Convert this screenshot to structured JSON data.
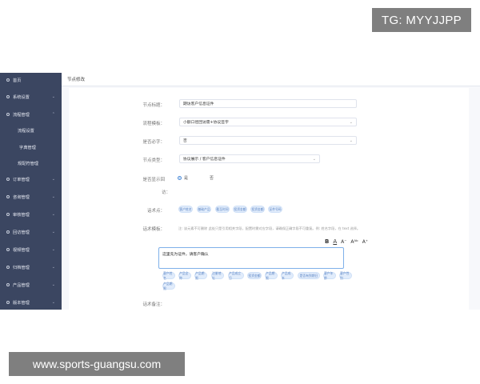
{
  "watermarks": {
    "top": "TG: MYYJJPP",
    "bottom": "www.sports-guangsu.com"
  },
  "sidebar": {
    "items": [
      {
        "label": "首页",
        "has_chevron": false
      },
      {
        "label": "系统设置",
        "has_chevron": true
      },
      {
        "label": "流程管理",
        "has_chevron": true
      },
      {
        "label": "流程设置",
        "sub": true
      },
      {
        "label": "字典管理",
        "sub": true
      },
      {
        "label": "规配符管理",
        "sub": true
      },
      {
        "label": "订单管理",
        "has_chevron": true
      },
      {
        "label": "咨询管理",
        "has_chevron": true
      },
      {
        "label": "审核管理",
        "has_chevron": true
      },
      {
        "label": "回访管理",
        "has_chevron": true
      },
      {
        "label": "视频管理",
        "has_chevron": true
      },
      {
        "label": "归档管理",
        "has_chevron": true
      },
      {
        "label": "产品管理",
        "has_chevron": true
      },
      {
        "label": "版本管理",
        "has_chevron": true
      }
    ]
  },
  "header": {
    "title": "节点修改"
  },
  "form": {
    "node_title": {
      "label": "节点标题：",
      "value": "期访客户信息证件"
    },
    "process_template": {
      "label": "流程模板：",
      "value": "小额口径回访需+协议签字"
    },
    "is_required": {
      "label": "是否必字：",
      "value": "否"
    },
    "node_type": {
      "label": "节点类型：",
      "value": "协议展示 / 客户信息证件"
    },
    "show_on_record": {
      "label_line1": "是否显示回",
      "label_line2": "访：",
      "options": [
        {
          "label": "是",
          "selected": true
        },
        {
          "label": "否",
          "selected": false
        }
      ]
    },
    "anchors": {
      "label": "话术点：",
      "chips": [
        "客户姓名",
        "基础产品",
        "截至时间",
        "投资金额",
        "投资金额",
        "证件号码"
      ]
    },
    "script_template": {
      "label": "话术模板：",
      "hint": "注: 该元素不可删除 此处只是引用相关字段，配置时需对应字段，请确保正确字段不可重复。例: 姓名字段，在 text 选择。",
      "toolbar": [
        "B",
        "A",
        "A⁻",
        "Aᴬᵇ",
        "A⁺"
      ],
      "content": "这里先为证件，请客户确认",
      "chips_row1": [
        "客户姓名",
        "产品全称",
        "产品期限",
        "注册地址",
        "产品成立日",
        "投资金额",
        "产品期限",
        "产品成本",
        "是否有到期日",
        "客户年龄",
        "客户性别"
      ],
      "chips_row2": [
        "产品期限"
      ]
    },
    "remarks": {
      "label": "话术备注："
    }
  },
  "colors": {
    "sidebar_bg": "#3b4661",
    "accent": "#4a8ad8",
    "chip_bg": "#e1ecfb"
  }
}
